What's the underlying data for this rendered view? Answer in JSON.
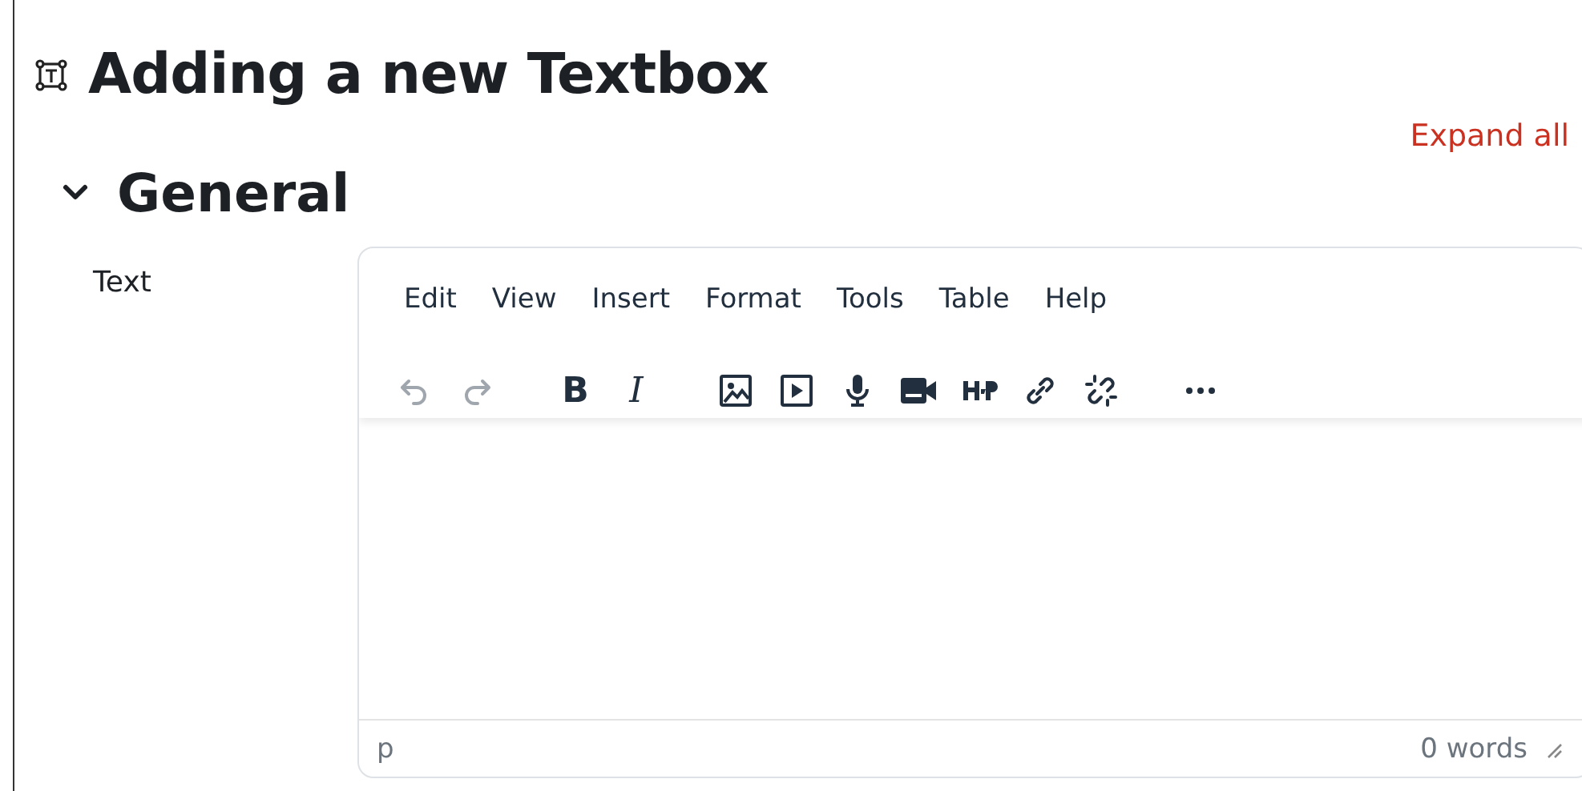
{
  "page": {
    "title": "Adding a new Textbox",
    "expand_link": "Expand all"
  },
  "section": {
    "title": "General",
    "expanded": true
  },
  "field": {
    "label": "Text",
    "editor": {
      "menu": [
        "Edit",
        "View",
        "Insert",
        "Format",
        "Tools",
        "Table",
        "Help"
      ],
      "toolbar": [
        {
          "kind": "undo",
          "disabled": true
        },
        {
          "kind": "redo",
          "disabled": true
        },
        {
          "kind": "bold",
          "label": "B",
          "disabled": false
        },
        {
          "kind": "italic",
          "label": "I",
          "disabled": false
        },
        {
          "kind": "image",
          "disabled": false
        },
        {
          "kind": "media",
          "disabled": false
        },
        {
          "kind": "mic",
          "disabled": false
        },
        {
          "kind": "camera",
          "disabled": false
        },
        {
          "kind": "logo",
          "disabled": false
        },
        {
          "kind": "link",
          "disabled": false
        },
        {
          "kind": "unlink",
          "disabled": false
        },
        {
          "kind": "more",
          "disabled": false
        }
      ],
      "path": "p",
      "word_count": "0 words"
    }
  }
}
